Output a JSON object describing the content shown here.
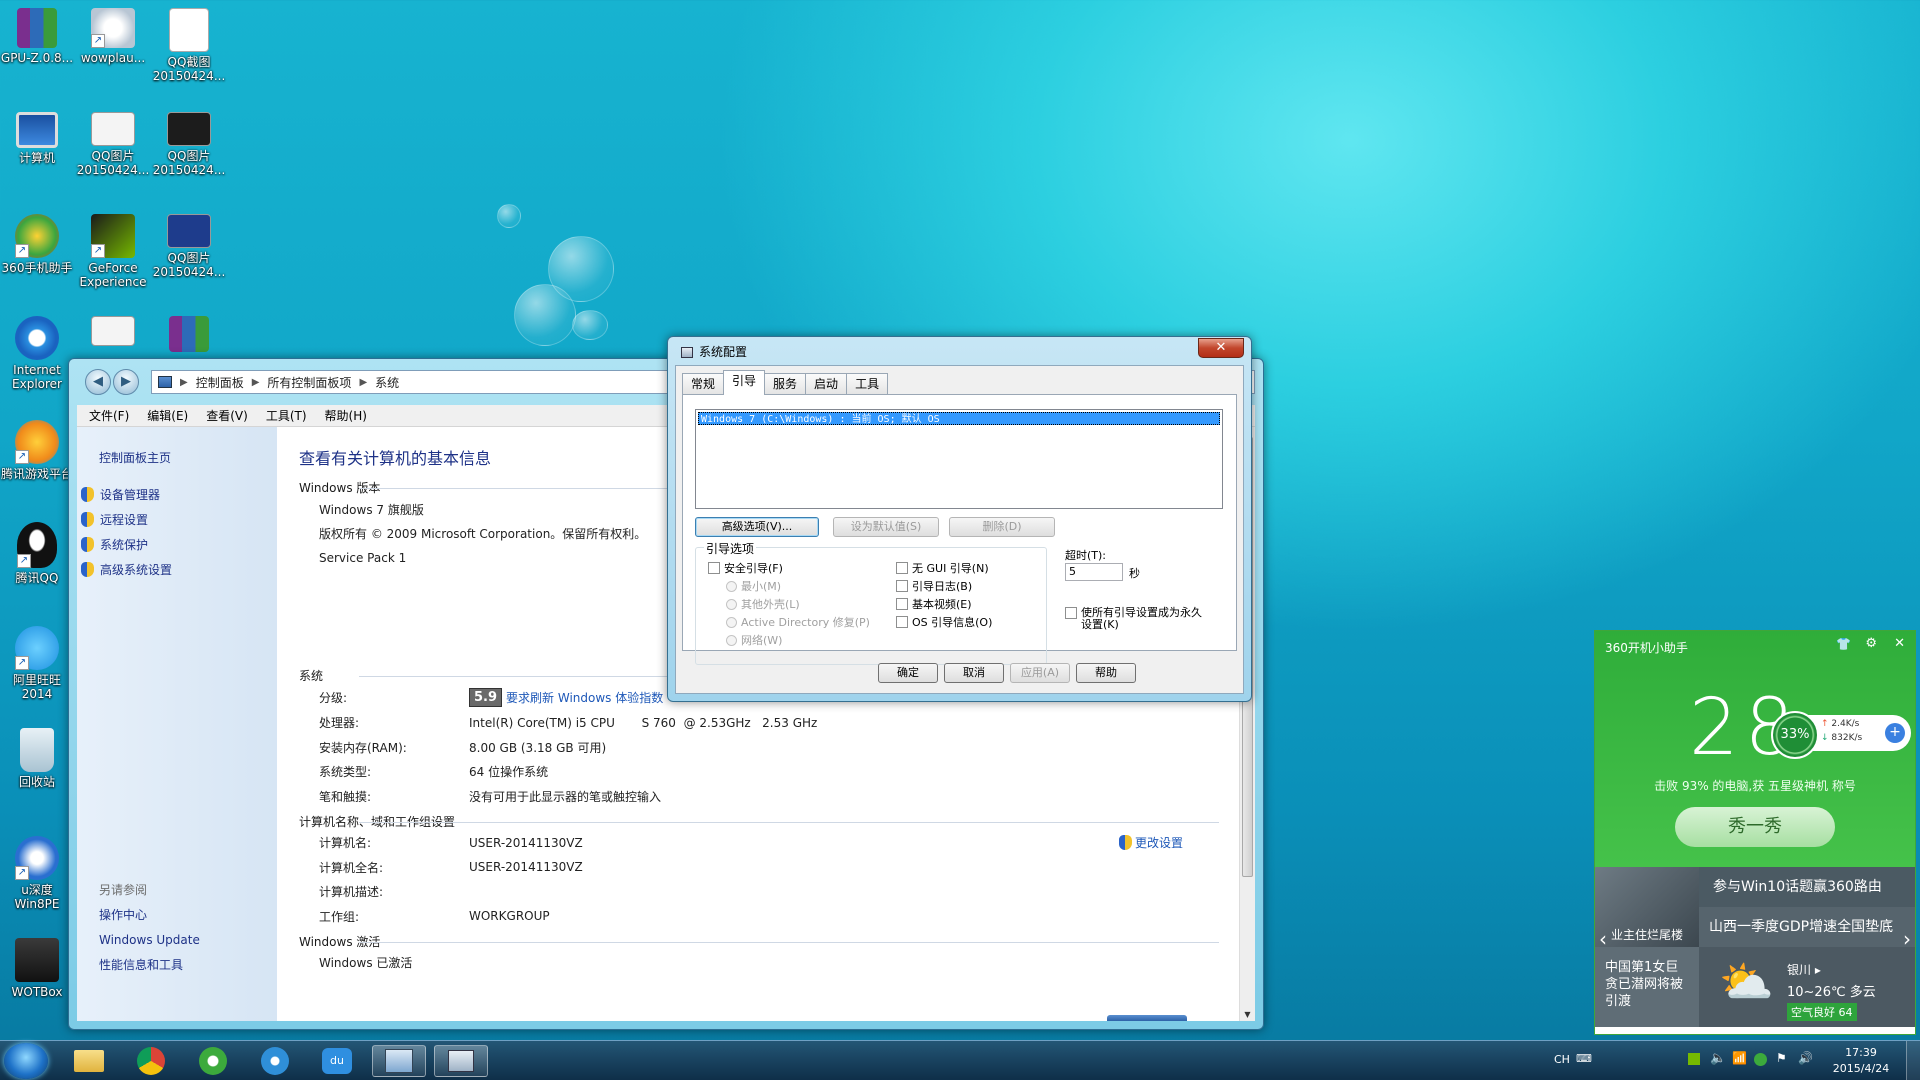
{
  "desktop": {
    "icons": [
      {
        "label": "GPU-Z.0.8..."
      },
      {
        "label": "wowplau..."
      },
      {
        "label": "QQ截图 20150424..."
      },
      {
        "label": "计算机"
      },
      {
        "label": "QQ图片 20150424..."
      },
      {
        "label": "QQ图片 20150424..."
      },
      {
        "label": "360手机助手"
      },
      {
        "label": "GeForce Experience"
      },
      {
        "label": "QQ图片 20150424..."
      },
      {
        "label": "Internet Explorer"
      },
      {
        "label": "腾讯游戏平台"
      },
      {
        "label": "腾讯QQ"
      },
      {
        "label": "阿里旺旺 2014"
      },
      {
        "label": "回收站"
      },
      {
        "label": "u深度 Win8PE"
      },
      {
        "label": "WOTBox"
      }
    ]
  },
  "control_panel": {
    "breadcrumb": [
      "控制面板",
      "所有控制面板项",
      "系统"
    ],
    "menu": [
      "文件(F)",
      "编辑(E)",
      "查看(V)",
      "工具(T)",
      "帮助(H)"
    ],
    "sidebar": {
      "home": "控制面板主页",
      "items": [
        "设备管理器",
        "远程设置",
        "系统保护",
        "高级系统设置"
      ],
      "see_also": "另请参阅",
      "see_also_items": [
        "操作中心",
        "Windows Update",
        "性能信息和工具"
      ]
    },
    "heading": "查看有关计算机的基本信息",
    "edition": {
      "section": "Windows 版本",
      "name": "Windows 7 旗舰版",
      "copyright": "版权所有 © 2009 Microsoft Corporation。保留所有权利。",
      "service_pack": "Service Pack 1"
    },
    "system": {
      "section": "系统",
      "rating_label": "分级:",
      "rating_value": "5.9",
      "rating_link": "要求刷新 Windows 体验指数",
      "processor_label": "处理器:",
      "processor_value": "Intel(R) Core(TM) i5 CPU       S 760  @ 2.53GHz   2.53 GHz",
      "ram_label": "安装内存(RAM):",
      "ram_value": "8.00 GB (3.18 GB 可用)",
      "type_label": "系统类型:",
      "type_value": "64 位操作系统",
      "pen_label": "笔和触摸:",
      "pen_value": "没有可用于此显示器的笔或触控输入"
    },
    "computer": {
      "section": "计算机名称、域和工作组设置",
      "change_link": "更改设置",
      "name_label": "计算机名:",
      "name_value": "USER-20141130VZ",
      "fullname_label": "计算机全名:",
      "fullname_value": "USER-20141130VZ",
      "desc_label": "计算机描述:",
      "desc_value": "",
      "workgroup_label": "工作组:",
      "workgroup_value": "WORKGROUP"
    },
    "activation": {
      "section": "Windows 激活",
      "partial": "Windows 已激活"
    }
  },
  "msconfig": {
    "title": "系统配置",
    "tabs": [
      "常规",
      "引导",
      "服务",
      "启动",
      "工具"
    ],
    "active_tab": "引导",
    "os_entry": "Windows 7 (C:\\Windows) : 当前 OS; 默认 OS",
    "buttons": {
      "advanced": "高级选项(V)...",
      "set_default": "设为默认值(S)",
      "delete": "删除(D)"
    },
    "boot_options": {
      "label": "引导选项",
      "safe_boot": "安全引导(F)",
      "minimal": "最小(M)",
      "alternate_shell": "其他外壳(L)",
      "ad_repair": "Active Directory 修复(P)",
      "network": "网络(W)",
      "no_gui": "无 GUI 引导(N)",
      "boot_log": "引导日志(B)",
      "base_video": "基本视频(E)",
      "os_info": "OS 引导信息(O)"
    },
    "timeout_label": "超时(T):",
    "timeout_value": "5",
    "timeout_unit": "秒",
    "permanent": "使所有引导设置成为永久设置(K)",
    "footer": {
      "ok": "确定",
      "cancel": "取消",
      "apply": "应用(A)",
      "help": "帮助"
    }
  },
  "widget_360": {
    "title": "360开机小助手",
    "seconds": "28",
    "percent": "33%",
    "upload": "2.4K/s",
    "download": "832K/s",
    "beat_text": "击败 93% 的电脑,获 五星级神机 称号",
    "show_button": "秀一秀",
    "news_image_caption": "业主住烂尾楼",
    "news1": "参与Win10话题赢360路由",
    "news2": "山西一季度GDP增速全国垫底",
    "news3": "中国第1女巨贪已潜网将被引渡",
    "weather_city": "银川",
    "weather_temp": "10~26℃ 多云",
    "air_quality": "空气良好 64"
  },
  "taskbar": {
    "lang": "CH",
    "time": "17:39",
    "date": "2015/4/24"
  }
}
